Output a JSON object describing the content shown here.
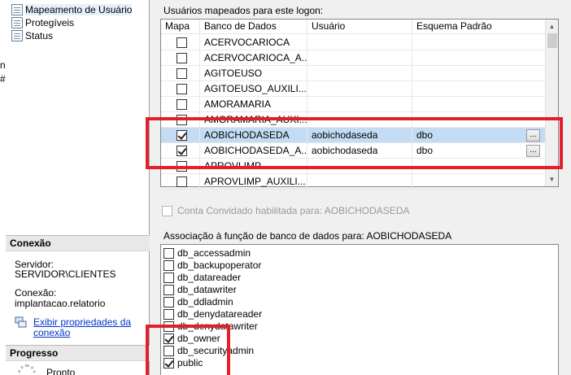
{
  "left": {
    "nav_items": [
      {
        "label": "Mapeamento de Usuário",
        "icon": "page-icon",
        "selected": true
      },
      {
        "label": "Protegíveis",
        "icon": "page-icon",
        "selected": false
      },
      {
        "label": "Status",
        "icon": "page-icon",
        "selected": false
      }
    ],
    "cut_letters": [
      "n",
      "#"
    ],
    "connection_header": "Conexão",
    "server_label": "Servidor:",
    "server_value": "SERVIDOR\\CLIENTES",
    "connection_label": "Conexão:",
    "connection_value": "implantacao.relatorio",
    "view_props_link": "Exibir propriedades da conexão",
    "view_props_link_line1": "Exibir propriedades da",
    "view_props_link_line2": "conexão",
    "progress_header": "Progresso",
    "progress_status": "Pronto"
  },
  "right": {
    "users_mapped_label": "Usuários mapeados para este logon:",
    "columns": [
      "Mapa",
      "Banco de Dados",
      "Usuário",
      "Esquema Padrão"
    ],
    "rows": [
      {
        "checked": false,
        "database": "ACERVOCARIOCA",
        "user": "",
        "schema": "",
        "selected": false,
        "ellipsis": false
      },
      {
        "checked": false,
        "database": "ACERVOCARIOCA_A...",
        "user": "",
        "schema": "",
        "selected": false,
        "ellipsis": false
      },
      {
        "checked": false,
        "database": "AGITOEUSO",
        "user": "",
        "schema": "",
        "selected": false,
        "ellipsis": false
      },
      {
        "checked": false,
        "database": "AGITOEUSO_AUXILI...",
        "user": "",
        "schema": "",
        "selected": false,
        "ellipsis": false
      },
      {
        "checked": false,
        "database": "AMORAMARIA",
        "user": "",
        "schema": "",
        "selected": false,
        "ellipsis": false
      },
      {
        "checked": false,
        "database": "AMORAMARIA_AUXI...",
        "user": "",
        "schema": "",
        "selected": false,
        "ellipsis": false
      },
      {
        "checked": true,
        "database": "AOBICHODASEDA",
        "user": "aobichodaseda",
        "schema": "dbo",
        "selected": true,
        "ellipsis": true
      },
      {
        "checked": true,
        "database": "AOBICHODASEDA_A...",
        "user": "aobichodaseda",
        "schema": "dbo",
        "selected": false,
        "ellipsis": true
      },
      {
        "checked": false,
        "database": "APROVLIMP",
        "user": "",
        "schema": "",
        "selected": false,
        "ellipsis": false
      },
      {
        "checked": false,
        "database": "APROVLIMP_AUXILI...",
        "user": "",
        "schema": "",
        "selected": false,
        "ellipsis": false
      }
    ],
    "ellipsis_label": "...",
    "guest_checkbox_label": "Conta Convidado habilitada para: AOBICHODASEDA",
    "guest_checked": false,
    "roles_label": "Associação à função de banco de dados para: AOBICHODASEDA",
    "roles": [
      {
        "name": "db_accessadmin",
        "checked": false
      },
      {
        "name": "db_backupoperator",
        "checked": false
      },
      {
        "name": "db_datareader",
        "checked": false
      },
      {
        "name": "db_datawriter",
        "checked": false
      },
      {
        "name": "db_ddladmin",
        "checked": false
      },
      {
        "name": "db_denydatareader",
        "checked": false
      },
      {
        "name": "db_denydatawriter",
        "checked": false
      },
      {
        "name": "db_owner",
        "checked": true
      },
      {
        "name": "db_securityadmin",
        "checked": false
      },
      {
        "name": "public",
        "checked": true
      }
    ]
  },
  "colors": {
    "highlight": "#e3202a",
    "selected_row": "#c4dcf3",
    "link": "#0033cc"
  }
}
